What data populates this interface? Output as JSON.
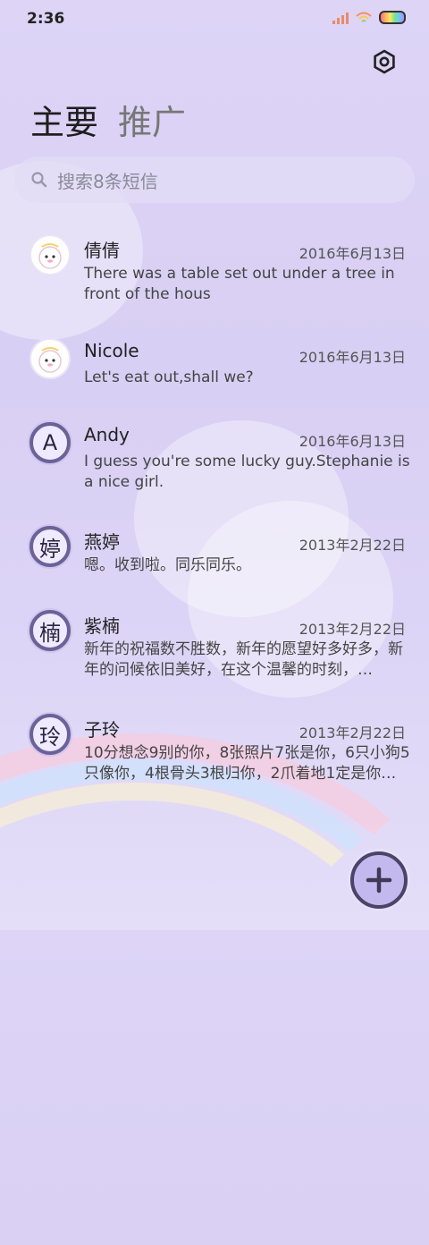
{
  "status_bar": {
    "time": "2:36"
  },
  "header": {
    "tabs": [
      {
        "label": "主要"
      },
      {
        "label": "推广"
      }
    ]
  },
  "search": {
    "placeholder": "搜索8条短信"
  },
  "conversations": [
    {
      "name": "倩倩",
      "date": "2016年6月13日",
      "message": "There was a table set out under a tree in front of the hous",
      "avatar": "photo"
    },
    {
      "name": "Nicole",
      "date": "2016年6月13日",
      "message": "Let's eat out,shall we?",
      "avatar": "photo"
    },
    {
      "name": "Andy",
      "date": "2016年6月13日",
      "message": "I guess you're some lucky guy.Stephanie is a nice girl.",
      "avatar": "A"
    },
    {
      "name": "燕婷",
      "date": "2013年2月22日",
      "message": "嗯。收到啦。同乐同乐。",
      "avatar": "婷"
    },
    {
      "name": "紫楠",
      "date": "2013年2月22日",
      "message": "新年的祝福数不胜数，新年的愿望好多好多，新年的问候依旧美好，在这个温馨的时刻，…",
      "avatar": "楠"
    },
    {
      "name": "子玲",
      "date": "2013年2月22日",
      "message": "10分想念9别的你，8张照片7张是你，6只小狗5只像你，4根骨头3根归你，2爪着地1定是你…",
      "avatar": "玲"
    }
  ],
  "icons": {
    "settings": "settings-icon",
    "search": "search-icon",
    "compose": "plus-icon"
  },
  "colors": {
    "background": "#ddd4f6",
    "accent": "#6c6297",
    "fab": "#c4b9ef"
  }
}
